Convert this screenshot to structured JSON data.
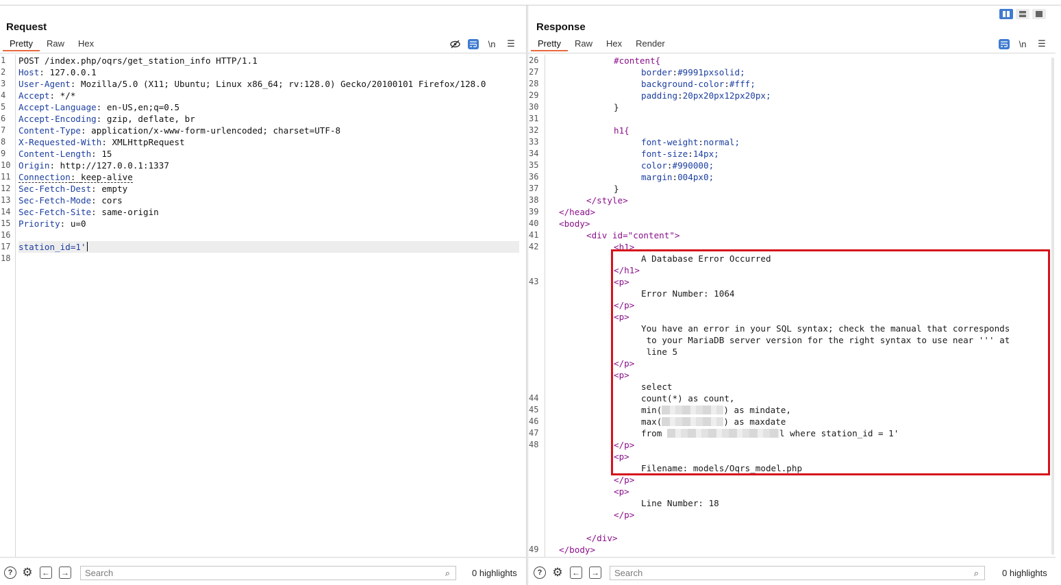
{
  "request": {
    "title": "Request",
    "tabs": [
      "Pretty",
      "Raw",
      "Hex"
    ],
    "active_tab": "Pretty",
    "tool_newline": "\\n",
    "lines": [
      {
        "n": "1",
        "key": "",
        "value": "POST /index.php/oqrs/get_station_info HTTP/1.1"
      },
      {
        "n": "2",
        "key": "Host",
        "value": "127.0.0.1"
      },
      {
        "n": "3",
        "key": "User-Agent",
        "value": "Mozilla/5.0 (X11; Ubuntu; Linux x86_64; rv:128.0) Gecko/20100101 Firefox/128.0"
      },
      {
        "n": "4",
        "key": "Accept",
        "value": "*/*"
      },
      {
        "n": "5",
        "key": "Accept-Language",
        "value": "en-US,en;q=0.5"
      },
      {
        "n": "6",
        "key": "Accept-Encoding",
        "value": "gzip, deflate, br"
      },
      {
        "n": "7",
        "key": "Content-Type",
        "value": "application/x-www-form-urlencoded; charset=UTF-8"
      },
      {
        "n": "8",
        "key": "X-Requested-With",
        "value": "XMLHttpRequest"
      },
      {
        "n": "9",
        "key": "Content-Length",
        "value": "15"
      },
      {
        "n": "10",
        "key": "Origin",
        "value": "http://127.0.0.1:1337"
      },
      {
        "n": "11",
        "key": "Connection",
        "value": "keep-alive"
      },
      {
        "n": "12",
        "key": "Sec-Fetch-Dest",
        "value": "empty"
      },
      {
        "n": "13",
        "key": "Sec-Fetch-Mode",
        "value": "cors"
      },
      {
        "n": "14",
        "key": "Sec-Fetch-Site",
        "value": "same-origin"
      },
      {
        "n": "15",
        "key": "Priority",
        "value": "u=0"
      },
      {
        "n": "16",
        "key": "",
        "value": ""
      },
      {
        "n": "17",
        "key": "",
        "value": "station_id=1'"
      },
      {
        "n": "18",
        "key": "",
        "value": ""
      }
    ],
    "search_placeholder": "Search",
    "highlights": "0 highlights"
  },
  "response": {
    "title": "Response",
    "tabs": [
      "Pretty",
      "Raw",
      "Hex",
      "Render"
    ],
    "active_tab": "Pretty",
    "tool_newline": "\\n",
    "line_numbers": [
      "26",
      "27",
      "28",
      "29",
      "30",
      "31",
      "32",
      "33",
      "34",
      "35",
      "36",
      "37",
      "38",
      "39",
      "40",
      "41",
      "42",
      "43",
      "44",
      "45",
      "46",
      "47",
      "48",
      "49"
    ],
    "css_content_selector": "#content{",
    "css_border": [
      "border",
      "#9991pxsolid;"
    ],
    "css_bg": [
      "background-color",
      "#fff;"
    ],
    "css_padding": [
      "padding",
      "20px20px12px20px;"
    ],
    "close_brace": "}",
    "css_h1_selector": "h1{",
    "css_fw": [
      "font-weight",
      "normal;"
    ],
    "css_fs": [
      "font-size",
      "14px;"
    ],
    "css_color": [
      "color",
      "#990000;"
    ],
    "css_margin": [
      "margin",
      "004px0;"
    ],
    "tag_style_close": "</style>",
    "tag_head_close": "</head>",
    "tag_body_open": "<body>",
    "div_open": "<div id=\"content\">",
    "tag_h1_open": "<h1>",
    "tag_h1_close": "</h1>",
    "tag_p_open": "<p>",
    "tag_p_close": "</p>",
    "tag_div_close": "</div>",
    "tag_body_close": "</body>",
    "error_heading": "A Database Error Occurred",
    "error_number": "Error Number: 1064",
    "sql_error_1": "You have an error in your SQL syntax; check the manual that corresponds",
    "sql_error_2": " to your MariaDB server version for the right syntax to use near ''' at",
    "sql_error_3": " line 5",
    "sql_select": "select",
    "sql_count": "count(*) as count,",
    "sql_min_pre": "min(",
    "sql_min_post": ") as mindate,",
    "sql_max_pre": "max(",
    "sql_max_post": ") as maxdate",
    "sql_from_pre": "from ",
    "sql_from_post": "l where station_id = 1'",
    "filename": "Filename: models/Oqrs_model.php",
    "line_number": "Line Number: 18",
    "search_placeholder": "Search",
    "highlights": "0 highlights"
  },
  "colors": {
    "accent_tab": "#e8683e",
    "highlight_box": "#d6111b",
    "button_blue": "#3f7bd1"
  }
}
